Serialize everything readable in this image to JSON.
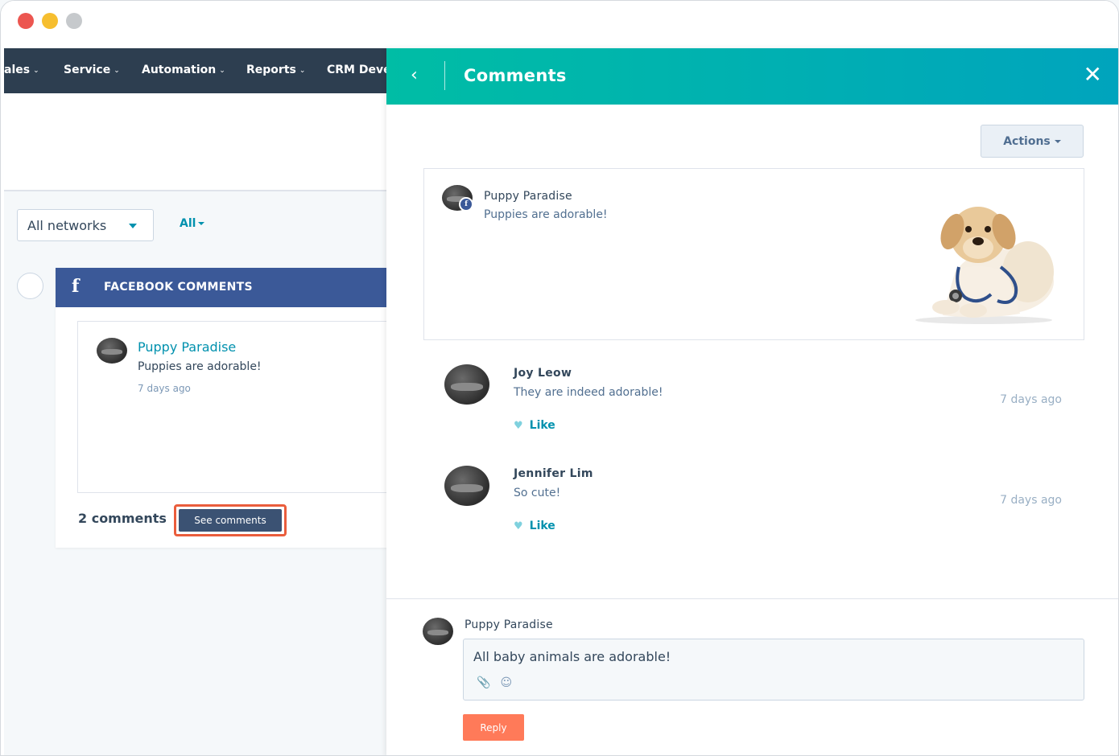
{
  "window": {
    "controls": [
      "close",
      "minimize",
      "zoom"
    ]
  },
  "nav": {
    "items": [
      {
        "label": "ales",
        "key": "sales"
      },
      {
        "label": "Service",
        "key": "service"
      },
      {
        "label": "Automation",
        "key": "automation"
      },
      {
        "label": "Reports",
        "key": "reports"
      },
      {
        "label": "CRM Deve",
        "key": "crm"
      }
    ]
  },
  "filters": {
    "networks": "All networks",
    "all": "All"
  },
  "feed": {
    "header": "FACEBOOK COMMENTS",
    "post": {
      "author": "Puppy Paradise",
      "text": "Puppies are adorable!",
      "time": "7 days ago"
    },
    "comment_count": "2 comments",
    "see_comments": "See comments"
  },
  "panel": {
    "title": "Comments",
    "actions_label": "Actions",
    "original_post": {
      "author": "Puppy Paradise",
      "text": "Puppies are adorable!"
    },
    "comments": [
      {
        "author": "Joy Leow",
        "text": "They are indeed adorable!",
        "time": "7 days ago",
        "like": "Like"
      },
      {
        "author": "Jennifer Lim",
        "text": "So cute!",
        "time": "7 days ago",
        "like": "Like"
      }
    ],
    "reply": {
      "author": "Puppy Paradise",
      "text": "All baby animals are adorable!",
      "button": "Reply"
    }
  },
  "colors": {
    "accent": "#00a4bd",
    "facebook": "#3b5998",
    "reply": "#ff7a59",
    "highlight": "#ea5d3c"
  }
}
